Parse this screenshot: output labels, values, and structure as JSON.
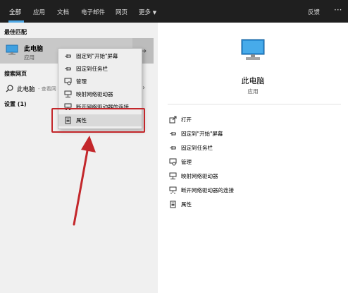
{
  "tabs": [
    {
      "label": "全部",
      "active": true
    },
    {
      "label": "应用"
    },
    {
      "label": "文档"
    },
    {
      "label": "电子邮件"
    },
    {
      "label": "网页"
    },
    {
      "label": "更多"
    }
  ],
  "header": {
    "feedback": "反馈",
    "more_icon": "ellipsis-icon"
  },
  "left": {
    "best_match_title": "最佳匹配",
    "best_match": {
      "name": "此电脑",
      "type": "应用"
    },
    "search_web_title": "搜索网页",
    "search_web_item": "此电脑",
    "search_web_suffix": " - 查看网",
    "settings_title": "设置 (1)"
  },
  "context_menu": [
    {
      "label": "固定到\"开始\"屏幕",
      "icon": "pin-icon"
    },
    {
      "label": "固定到任务栏",
      "icon": "pin-icon"
    },
    {
      "label": "管理",
      "icon": "manage-icon"
    },
    {
      "label": "映射网络驱动器",
      "icon": "network-drive-icon"
    },
    {
      "label": "断开网络驱动器的连接",
      "icon": "disconnect-drive-icon"
    },
    {
      "label": "属性",
      "icon": "properties-icon",
      "highlighted": true
    }
  ],
  "preview": {
    "name": "此电脑",
    "type": "应用"
  },
  "actions": [
    {
      "label": "打开",
      "icon": "open-icon"
    },
    {
      "label": "固定到\"开始\"屏幕",
      "icon": "pin-icon"
    },
    {
      "label": "固定到任务栏",
      "icon": "pin-icon"
    },
    {
      "label": "管理",
      "icon": "manage-icon"
    },
    {
      "label": "映射网络驱动器",
      "icon": "network-drive-icon"
    },
    {
      "label": "断开网络驱动器的连接",
      "icon": "disconnect-drive-icon"
    },
    {
      "label": "属性",
      "icon": "properties-icon"
    }
  ],
  "colors": {
    "accent": "#4ea7e4",
    "annotation_red": "#c3272b",
    "topbar": "#1f1f1f"
  }
}
